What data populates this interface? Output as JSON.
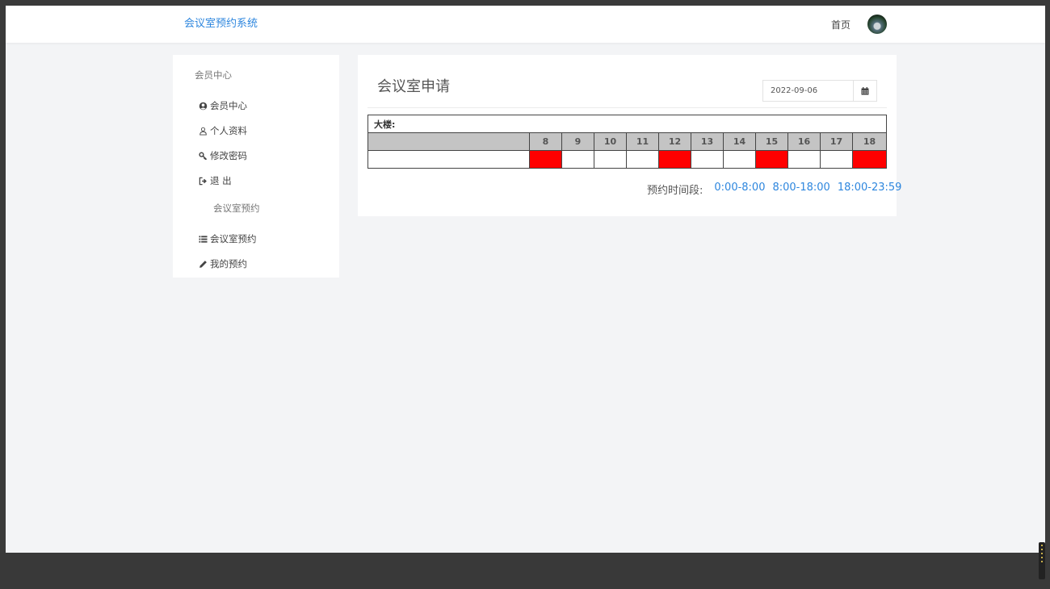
{
  "brand": "会议室预约系统",
  "nav": {
    "home": "首页"
  },
  "sidebar": {
    "section1": "会员中心",
    "items1": [
      {
        "label": "会员中心",
        "icon": "user-circle-icon"
      },
      {
        "label": "个人资料",
        "icon": "user-icon"
      },
      {
        "label": "修改密码",
        "icon": "key-icon"
      },
      {
        "label": "退 出",
        "icon": "sign-out-icon"
      }
    ],
    "section2": "会议室预约",
    "items2": [
      {
        "label": "会议室预约",
        "icon": "list-icon"
      },
      {
        "label": "我的预约",
        "icon": "pencil-icon"
      }
    ]
  },
  "panel": {
    "title": "会议室申请",
    "date": "2022-09-06"
  },
  "schedule": {
    "building_label": "大楼:",
    "hours": [
      "8",
      "9",
      "10",
      "11",
      "12",
      "13",
      "14",
      "15",
      "16",
      "17",
      "18"
    ],
    "booked": [
      true,
      false,
      false,
      false,
      true,
      false,
      false,
      true,
      false,
      false,
      true
    ],
    "booked_color": "#ff0000"
  },
  "periods": {
    "label": "预约时间段:",
    "links": [
      "0:00-8:00",
      "8:00-18:00",
      "18:00-23:59"
    ]
  },
  "colors": {
    "accent": "#2d86de"
  }
}
